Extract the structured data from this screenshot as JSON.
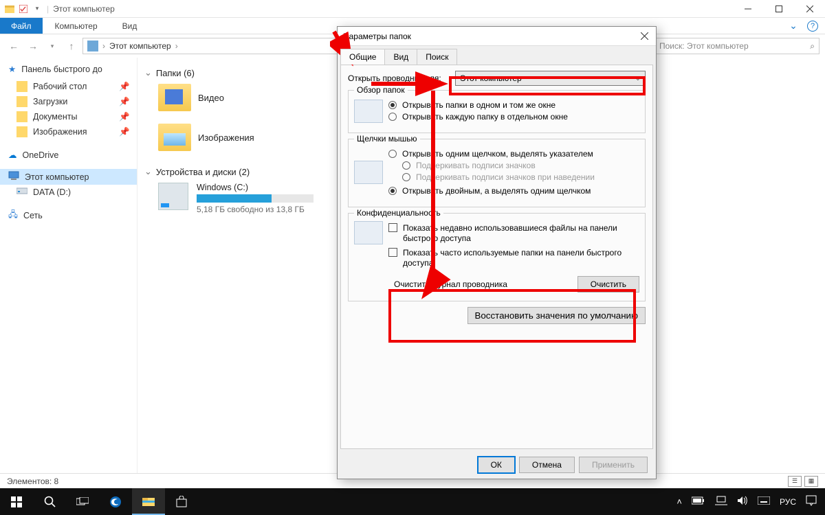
{
  "window": {
    "title": "Этот компьютер",
    "sep": "|"
  },
  "ribbon": {
    "file": "Файл",
    "tabs": [
      "Компьютер",
      "Вид"
    ]
  },
  "nav": {
    "breadcrumb": "Этот компьютер",
    "breadcrumb_sep": "›",
    "search_placeholder": "Поиск: Этот компьютер"
  },
  "sidebar": {
    "quick": "Панель быстрого до",
    "quick_items": [
      {
        "label": "Рабочий стол"
      },
      {
        "label": "Загрузки"
      },
      {
        "label": "Документы"
      },
      {
        "label": "Изображения"
      }
    ],
    "onedrive": "OneDrive",
    "thispc": "Этот компьютер",
    "data": "DATA (D:)",
    "network": "Сеть"
  },
  "content": {
    "folders_header": "Папки (6)",
    "folders": [
      {
        "label": "Видео"
      },
      {
        "label": "Изображения"
      }
    ],
    "drives_header": "Устройства и диски (2)",
    "drive": {
      "label": "Windows (C:)",
      "free": "5,18 ГБ свободно из 13,8 ГБ"
    }
  },
  "status": {
    "items": "Элементов: 8"
  },
  "dialog": {
    "title": "Параметры папок",
    "tabs": [
      "Общие",
      "Вид",
      "Поиск"
    ],
    "open_label": "Открыть проводник для:",
    "open_value": "Этот компьютер",
    "browse": {
      "title": "Обзор папок",
      "opt1": "Открывать папки в одном и том же окне",
      "opt2": "Открывать каждую папку в отдельном окне"
    },
    "click": {
      "title": "Щелчки мышью",
      "opt1": "Открывать одним щелчком, выделять указателем",
      "sub1": "Подчеркивать подписи значков",
      "sub2": "Подчеркивать подписи значков при наведении",
      "opt2": "Открывать двойным, а выделять одним щелчком"
    },
    "privacy": {
      "title": "Конфиденциальность",
      "chk1": "Показать недавно использовавшиеся файлы на панели быстрого доступа",
      "chk2": "Показать часто используемые папки на панели быстрого доступа",
      "clear_label": "Очистить журнал проводника",
      "clear_btn": "Очистить"
    },
    "restore": "Восстановить значения по умолчанию",
    "ok": "ОК",
    "cancel": "Отмена",
    "apply": "Применить"
  },
  "taskbar": {
    "lang": "РУС"
  }
}
